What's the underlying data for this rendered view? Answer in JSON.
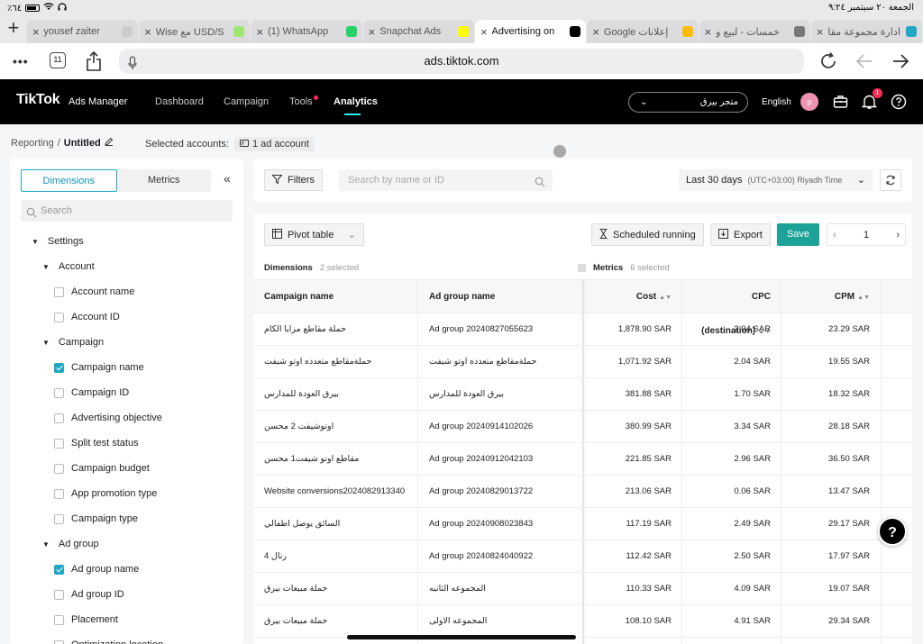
{
  "status_bar": {
    "battery": "٪٦٤",
    "datetime": "الجمعة ٢٠ سبتمبر  ٩:٢٤"
  },
  "browser": {
    "tabs": [
      {
        "title": "yousef zaiter",
        "active": false,
        "fav_color": "#cccccc"
      },
      {
        "title": "Wise مع USD/S",
        "active": false,
        "fav_color": "#9fe870"
      },
      {
        "title": "(1) WhatsApp",
        "active": false,
        "fav_color": "#25d366"
      },
      {
        "title": "Snapchat Ads",
        "active": false,
        "fav_color": "#fffc00"
      },
      {
        "title": "Advertising on",
        "active": true,
        "fav_color": "#000000"
      },
      {
        "title": "Google إعلانات",
        "active": false,
        "fav_color": "#fbbc04"
      },
      {
        "title": "خمسات - لبيع و",
        "active": false,
        "fav_color": "#777777"
      },
      {
        "title": "ادارة مجموعة مقا",
        "active": false,
        "fav_color": "#1fa7c4"
      }
    ],
    "tab_count": "11",
    "url": "ads.tiktok.com"
  },
  "header": {
    "logo": "TikTok",
    "logo_suffix": "Ads Manager",
    "nav": [
      "Dashboard",
      "Campaign",
      "Tools",
      "Analytics"
    ],
    "account_name": "متجر بيرق",
    "language": "English",
    "avatar_letter": "p",
    "notification_count": "1"
  },
  "breadcrumb": {
    "root": "Reporting",
    "current": "Untitled",
    "selected_accounts_label": "Selected accounts:",
    "account_chip": "1 ad account"
  },
  "left_panel": {
    "tab_dimensions": "Dimensions",
    "tab_metrics": "Metrics",
    "search_placeholder": "Search",
    "tree": [
      {
        "label": "Settings",
        "kind": "group",
        "level": 0
      },
      {
        "label": "Account",
        "kind": "group",
        "level": 1
      },
      {
        "label": "Account name",
        "kind": "item",
        "checked": false
      },
      {
        "label": "Account ID",
        "kind": "item",
        "checked": false
      },
      {
        "label": "Campaign",
        "kind": "group",
        "level": 1
      },
      {
        "label": "Campaign name",
        "kind": "item",
        "checked": true
      },
      {
        "label": "Campaign ID",
        "kind": "item",
        "checked": false
      },
      {
        "label": "Advertising objective",
        "kind": "item",
        "checked": false
      },
      {
        "label": "Split test status",
        "kind": "item",
        "checked": false
      },
      {
        "label": "Campaign budget",
        "kind": "item",
        "checked": false
      },
      {
        "label": "App promotion type",
        "kind": "item",
        "checked": false
      },
      {
        "label": "Campaign type",
        "kind": "item",
        "checked": false
      },
      {
        "label": "Ad group",
        "kind": "group",
        "level": 1
      },
      {
        "label": "Ad group name",
        "kind": "item",
        "checked": true
      },
      {
        "label": "Ad group ID",
        "kind": "item",
        "checked": false
      },
      {
        "label": "Placement",
        "kind": "item",
        "checked": false
      },
      {
        "label": "Optimization location",
        "kind": "item",
        "checked": false
      }
    ]
  },
  "filters": {
    "filters_label": "Filters",
    "search_placeholder": "Search by name or ID",
    "date_range": "Last 30 days",
    "timezone": "(UTC+03:00) Riyadh Time"
  },
  "toolbar": {
    "pivot_label": "Pivot table",
    "scheduled_label": "Scheduled running",
    "export_label": "Export",
    "save_label": "Save",
    "page": "1"
  },
  "table": {
    "dimensions_label": "Dimensions",
    "dimensions_count": "2 selected",
    "metrics_label": "Metrics",
    "metrics_count": "6 selected",
    "columns": [
      "Campaign name",
      "Ad group name",
      "Cost",
      "CPC (destination)",
      "CPM"
    ],
    "rows": [
      {
        "campaign": "حملة مقاطع مزايا الكام",
        "adgroup": "Ad group 20240827055623",
        "cost": "1,878.90 SAR",
        "cpc": "2.04 SAR",
        "cpm": "23.29 SAR"
      },
      {
        "campaign": "حملةمقاطع متعدده اوتو شيفت",
        "adgroup": "حملةمقاطع متعدده اوتو شيفت",
        "cost": "1,071.92 SAR",
        "cpc": "2.04 SAR",
        "cpm": "19.55 SAR"
      },
      {
        "campaign": "بيرق العودة للمدارس",
        "adgroup": "بيرق العودة للمدارس",
        "cost": "381.88 SAR",
        "cpc": "1.70 SAR",
        "cpm": "18.32 SAR"
      },
      {
        "campaign": "اوتوشيفت 2 محسن",
        "adgroup": "Ad group 20240914102026",
        "cost": "380.99 SAR",
        "cpc": "3.34 SAR",
        "cpm": "28.18 SAR"
      },
      {
        "campaign": "مقاطع اوتو شيفت1 محسن",
        "adgroup": "Ad group 20240912042103",
        "cost": "221.85 SAR",
        "cpc": "2.96 SAR",
        "cpm": "36.50 SAR"
      },
      {
        "campaign": "Website conversions2024082913340",
        "adgroup": "Ad group 20240829013722",
        "cost": "213.06 SAR",
        "cpc": "0.06 SAR",
        "cpm": "13.47 SAR"
      },
      {
        "campaign": "السائق يوصل اطفالي",
        "adgroup": "Ad group 20240908023843",
        "cost": "117.19 SAR",
        "cpc": "2.49 SAR",
        "cpm": "29.17 SAR"
      },
      {
        "campaign": "رنال 4",
        "adgroup": "Ad group 20240824040922",
        "cost": "112.42 SAR",
        "cpc": "2.50 SAR",
        "cpm": "17.97 SAR"
      },
      {
        "campaign": "حملة مبيعات بيرق",
        "adgroup": "المجموعه الثانيه",
        "cost": "110.33 SAR",
        "cpc": "4.09 SAR",
        "cpm": "19.07 SAR"
      },
      {
        "campaign": "حملة مبيعات بيرق",
        "adgroup": "المجموعه الاولى",
        "cost": "108.10 SAR",
        "cpc": "4.91 SAR",
        "cpm": "29.34 SAR"
      }
    ]
  },
  "colors": {
    "accent": "#1fa7c4",
    "save_button": "#1da298",
    "header_bg": "#000000",
    "badge": "#fe2c55"
  }
}
